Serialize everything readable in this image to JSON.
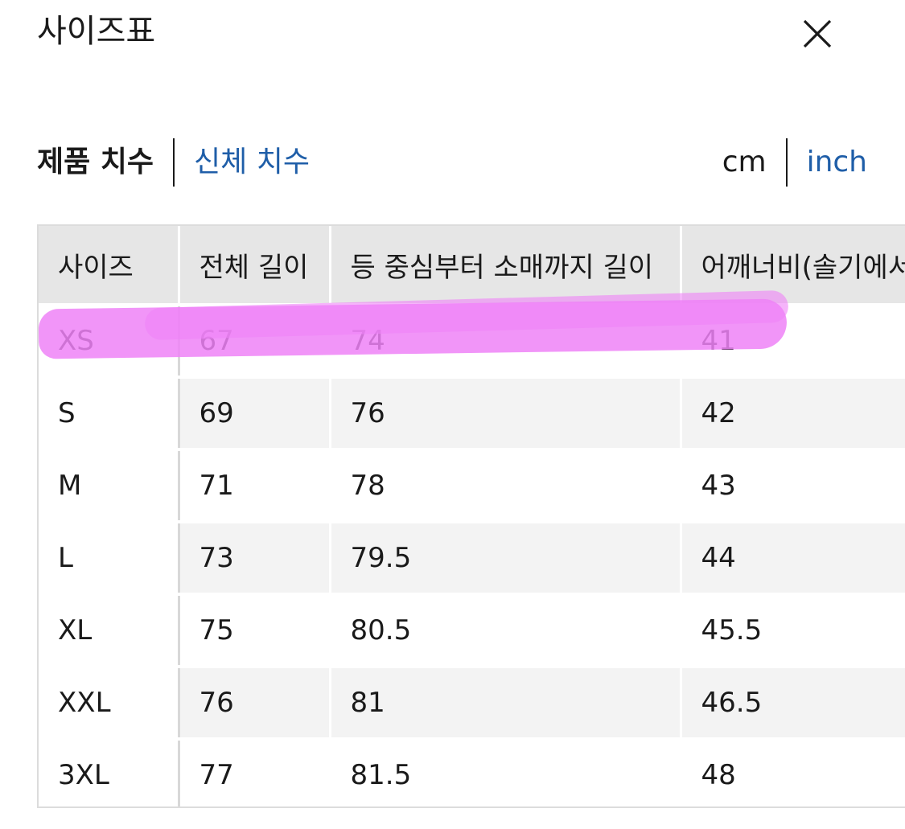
{
  "header": {
    "title": "사이즈표"
  },
  "tabs": [
    {
      "label": "제품 치수",
      "active": true
    },
    {
      "label": "신체 치수",
      "active": false
    }
  ],
  "units": [
    {
      "label": "cm",
      "active": true
    },
    {
      "label": "inch",
      "active": false
    }
  ],
  "colors": {
    "link": "#1f5ea8",
    "header_bg": "#e6e6e6",
    "stripe_bg": "#f3f3f3",
    "highlight": "#ee82f7"
  },
  "table": {
    "headers": [
      "사이즈",
      "전체 길이",
      "등 중심부터 소매까지 길이",
      "어깨너비(솔기에서"
    ],
    "rows": [
      [
        "XS",
        "67",
        "74",
        "41"
      ],
      [
        "S",
        "69",
        "76",
        "42"
      ],
      [
        "M",
        "71",
        "78",
        "43"
      ],
      [
        "L",
        "73",
        "79.5",
        "44"
      ],
      [
        "XL",
        "75",
        "80.5",
        "45.5"
      ],
      [
        "XXL",
        "76",
        "81",
        "46.5"
      ],
      [
        "3XL",
        "77",
        "81.5",
        "48"
      ]
    ],
    "highlighted_row": "XS"
  }
}
